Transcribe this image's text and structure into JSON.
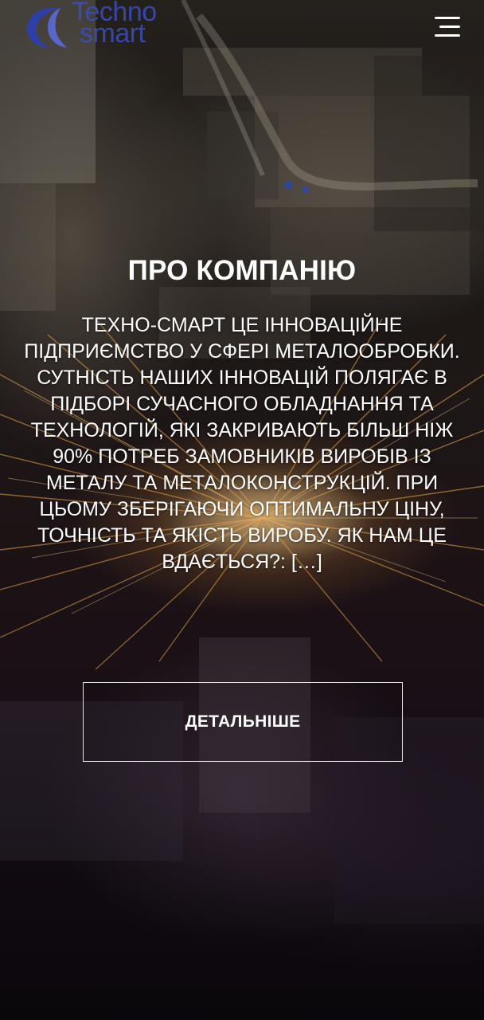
{
  "header": {
    "logo_line1": "Techno",
    "logo_line2": "smart",
    "menu_icon": "hamburger-menu-icon"
  },
  "about": {
    "title": "ПРО КОМПАНІЮ",
    "text": "ТЕХНО-СМАРТ ЦЕ ІННОВАЦІЙНЕ ПІДПРИЄМСТВО У СФЕРІ МЕТАЛООБРОБКИ. СУТНІСТЬ НАШИХ ІННОВАЦІЙ ПОЛЯГАЄ В ПІДБОРІ СУЧАСНОГО ОБЛАДНАННЯ ТА ТЕХНОЛОГІЙ, ЯКІ ЗАКРИВАЮТЬ БІЛЬШ НІЖ 90% ПОТРЕБ ЗАМОВНИКІВ ВИРОБІВ ІЗ МЕТАЛУ ТА МЕТАЛОКОНСТРУКЦІЙ. ПРИ ЦЬОМУ ЗБЕРІГАЮЧИ ОПТИМАЛЬНУ ЦІНУ, ТОЧНІСТЬ ТА ЯКІСТЬ ВИРОБУ. ЯК НАМ ЦЕ ВДАЄТЬСЯ?: […]",
    "button_label": "ДЕТАЛЬНІШЕ"
  },
  "colors": {
    "logo": "#3a4ec0",
    "text": "#ffffff",
    "spark": "#ffb450"
  }
}
